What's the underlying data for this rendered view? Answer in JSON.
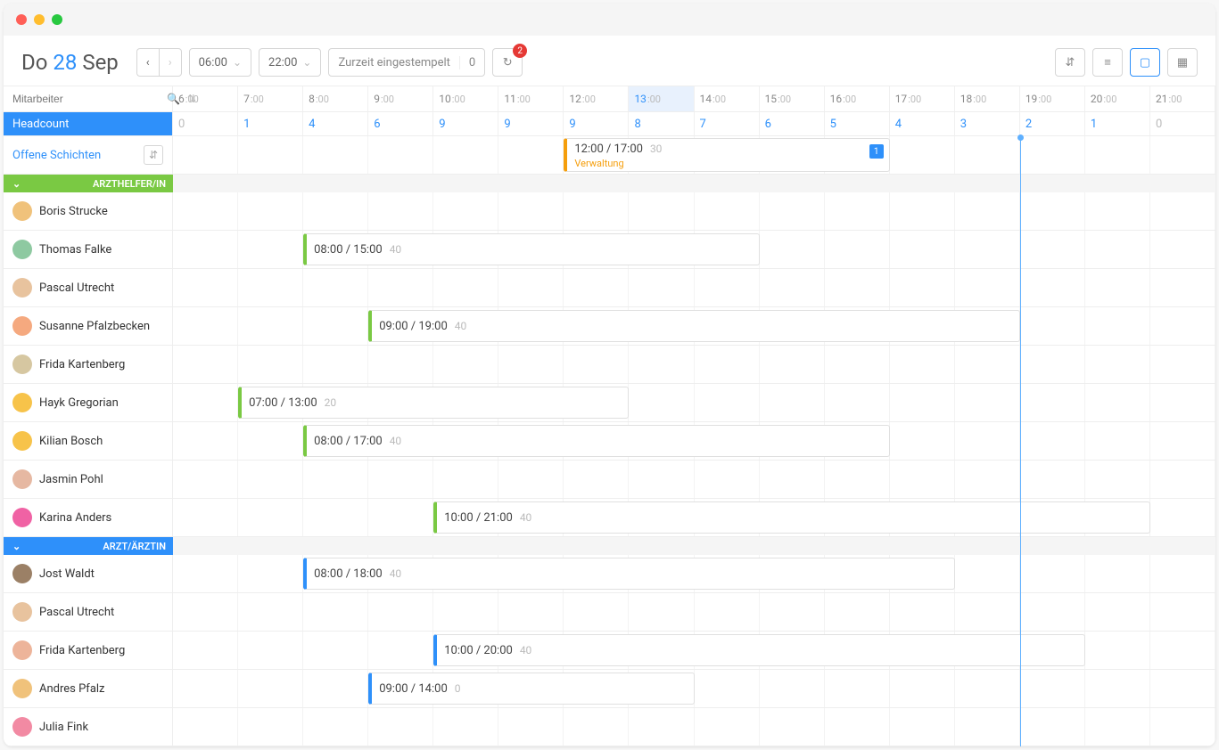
{
  "date": {
    "dow": "Do",
    "day": "28",
    "month": "Sep"
  },
  "timeFrom": "06:00",
  "timeTo": "22:00",
  "status": {
    "label": "Zurzeit eingestempelt",
    "count": "0"
  },
  "notification_badge": "2",
  "sidebar": {
    "search_placeholder": "Mitarbeiter",
    "headcount_label": "Headcount",
    "open_label": "Offene Schichten"
  },
  "hours": [
    "6",
    "7",
    "8",
    "9",
    "10",
    "11",
    "12",
    "13",
    "14",
    "15",
    "16",
    "17",
    "18",
    "19",
    "20",
    "21"
  ],
  "highlight_hour_index": 7,
  "headcount": [
    "0",
    "1",
    "4",
    "6",
    "9",
    "9",
    "9",
    "8",
    "7",
    "6",
    "5",
    "4",
    "3",
    "2",
    "1",
    "0"
  ],
  "openShift": {
    "time": "12:00 / 17:00",
    "extra": "30",
    "sub": "Verwaltung",
    "badge": "1",
    "startH": 12,
    "endH": 17
  },
  "groups": [
    {
      "name": "ARZTHELFER/IN",
      "color": "green",
      "employees": [
        {
          "name": "Boris Strucke",
          "shift": null,
          "avatar": "#f0c27b"
        },
        {
          "name": "Thomas Falke",
          "shift": {
            "time": "08:00 / 15:00",
            "extra": "40",
            "startH": 8,
            "endH": 15,
            "color": "#7ac943"
          },
          "avatar": "#8ec9a1"
        },
        {
          "name": "Pascal Utrecht",
          "shift": null,
          "avatar": "#e8c39e"
        },
        {
          "name": "Susanne Pfalzbecken",
          "shift": {
            "time": "09:00 / 19:00",
            "extra": "40",
            "startH": 9,
            "endH": 19,
            "color": "#7ac943"
          },
          "avatar": "#f5a97f"
        },
        {
          "name": "Frida Kartenberg",
          "shift": null,
          "avatar": "#d6c7a1"
        },
        {
          "name": "Hayk Gregorian",
          "shift": {
            "time": "07:00 / 13:00",
            "extra": "20",
            "startH": 7,
            "endH": 13,
            "color": "#7ac943"
          },
          "avatar": "#f7c34a"
        },
        {
          "name": "Kilian Bosch",
          "shift": {
            "time": "08:00 / 17:00",
            "extra": "40",
            "startH": 8,
            "endH": 17,
            "color": "#7ac943"
          },
          "avatar": "#f7c34a"
        },
        {
          "name": "Jasmin Pohl",
          "shift": null,
          "avatar": "#e6b8a2"
        },
        {
          "name": "Karina Anders",
          "shift": {
            "time": "10:00 / 21:00",
            "extra": "40",
            "startH": 10,
            "endH": 21,
            "color": "#7ac943"
          },
          "avatar": "#f062a4"
        }
      ]
    },
    {
      "name": "ARZT/ÄRZTIN",
      "color": "blue",
      "employees": [
        {
          "name": "Jost Waldt",
          "shift": {
            "time": "08:00 / 18:00",
            "extra": "40",
            "startH": 8,
            "endH": 18,
            "color": "#2e90fa"
          },
          "avatar": "#9b8066"
        },
        {
          "name": "Pascal Utrecht",
          "shift": null,
          "avatar": "#e8c39e"
        },
        {
          "name": "Frida Kartenberg",
          "shift": {
            "time": "10:00 / 20:00",
            "extra": "40",
            "startH": 10,
            "endH": 20,
            "color": "#2e90fa"
          },
          "avatar": "#edb49a"
        },
        {
          "name": "Andres Pfalz",
          "shift": {
            "time": "09:00 / 14:00",
            "extra": "0",
            "startH": 9,
            "endH": 14,
            "color": "#2e90fa"
          },
          "avatar": "#f0c27b"
        },
        {
          "name": "Julia Fink",
          "shift": null,
          "avatar": "#f28aa3"
        }
      ]
    }
  ],
  "now_position_hour": 19.0
}
